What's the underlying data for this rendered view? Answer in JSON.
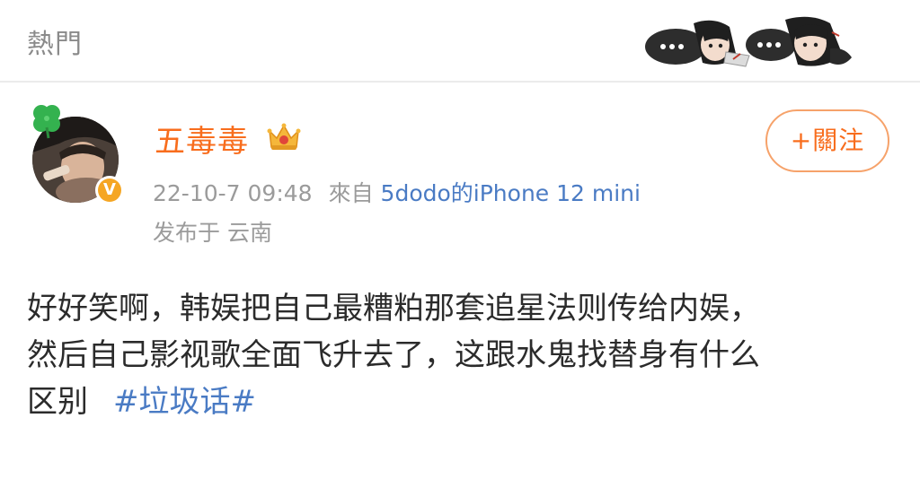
{
  "header": {
    "tab_label": "熱門"
  },
  "post": {
    "author": {
      "name": "五毒毒",
      "verified": true,
      "verify_mark": "V"
    },
    "date": "22-10-7",
    "time": "09:48",
    "source_prefix": "來自",
    "source": "5dodo的iPhone 12 mini",
    "location_line": "发布于 云南",
    "follow_label": "+關注",
    "text_lines": [
      "好好笑啊，韩娱把自己最糟粕那套追星法则传给内娱，",
      "然后自己影视歌全面飞升去了，这跟水鬼找替身有什么",
      "区别"
    ],
    "hashtag": "#垃圾话#"
  },
  "colors": {
    "username": "#f86d1d",
    "follow_border": "#f6a26a",
    "link_blue": "#4a7bc4",
    "meta_gray": "#9b9b9b",
    "body_text": "#2b2b2b"
  },
  "icons": {
    "clover": "four-leaf-clover-icon",
    "crown": "vip-crown-icon",
    "verify": "verified-badge-icon"
  }
}
